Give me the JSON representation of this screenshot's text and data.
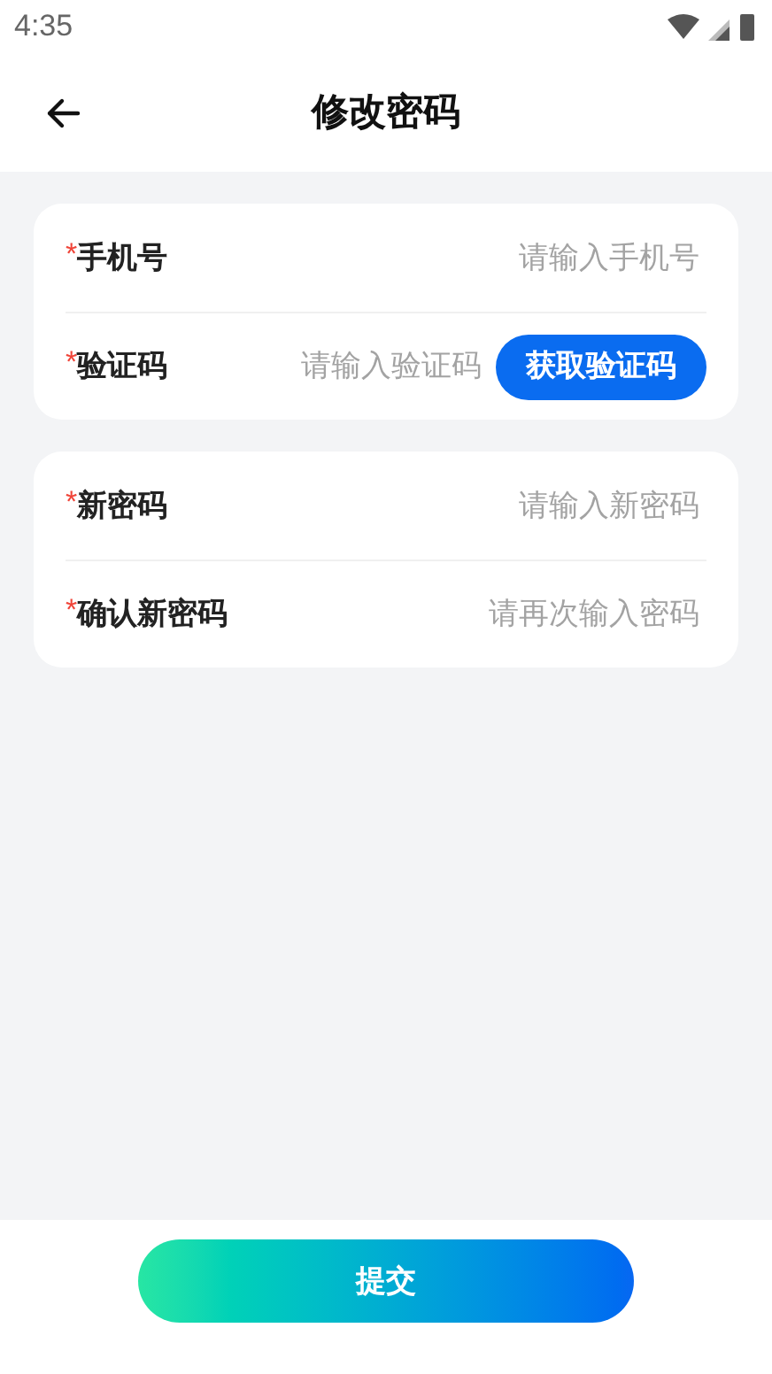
{
  "status_bar": {
    "time": "4:35"
  },
  "header": {
    "title": "修改密码"
  },
  "groups": [
    {
      "fields": [
        {
          "kind": "text",
          "label": "手机号",
          "required_mark": "*",
          "placeholder": "请输入手机号"
        },
        {
          "kind": "code",
          "label": "验证码",
          "required_mark": "*",
          "placeholder": "请输入验证码",
          "button": "获取验证码"
        }
      ]
    },
    {
      "fields": [
        {
          "kind": "text",
          "label": "新密码",
          "required_mark": "*",
          "placeholder": "请输入新密码"
        },
        {
          "kind": "text",
          "label": "确认新密码",
          "required_mark": "*",
          "placeholder": "请再次输入密码"
        }
      ]
    }
  ],
  "submit": {
    "label": "提交"
  }
}
